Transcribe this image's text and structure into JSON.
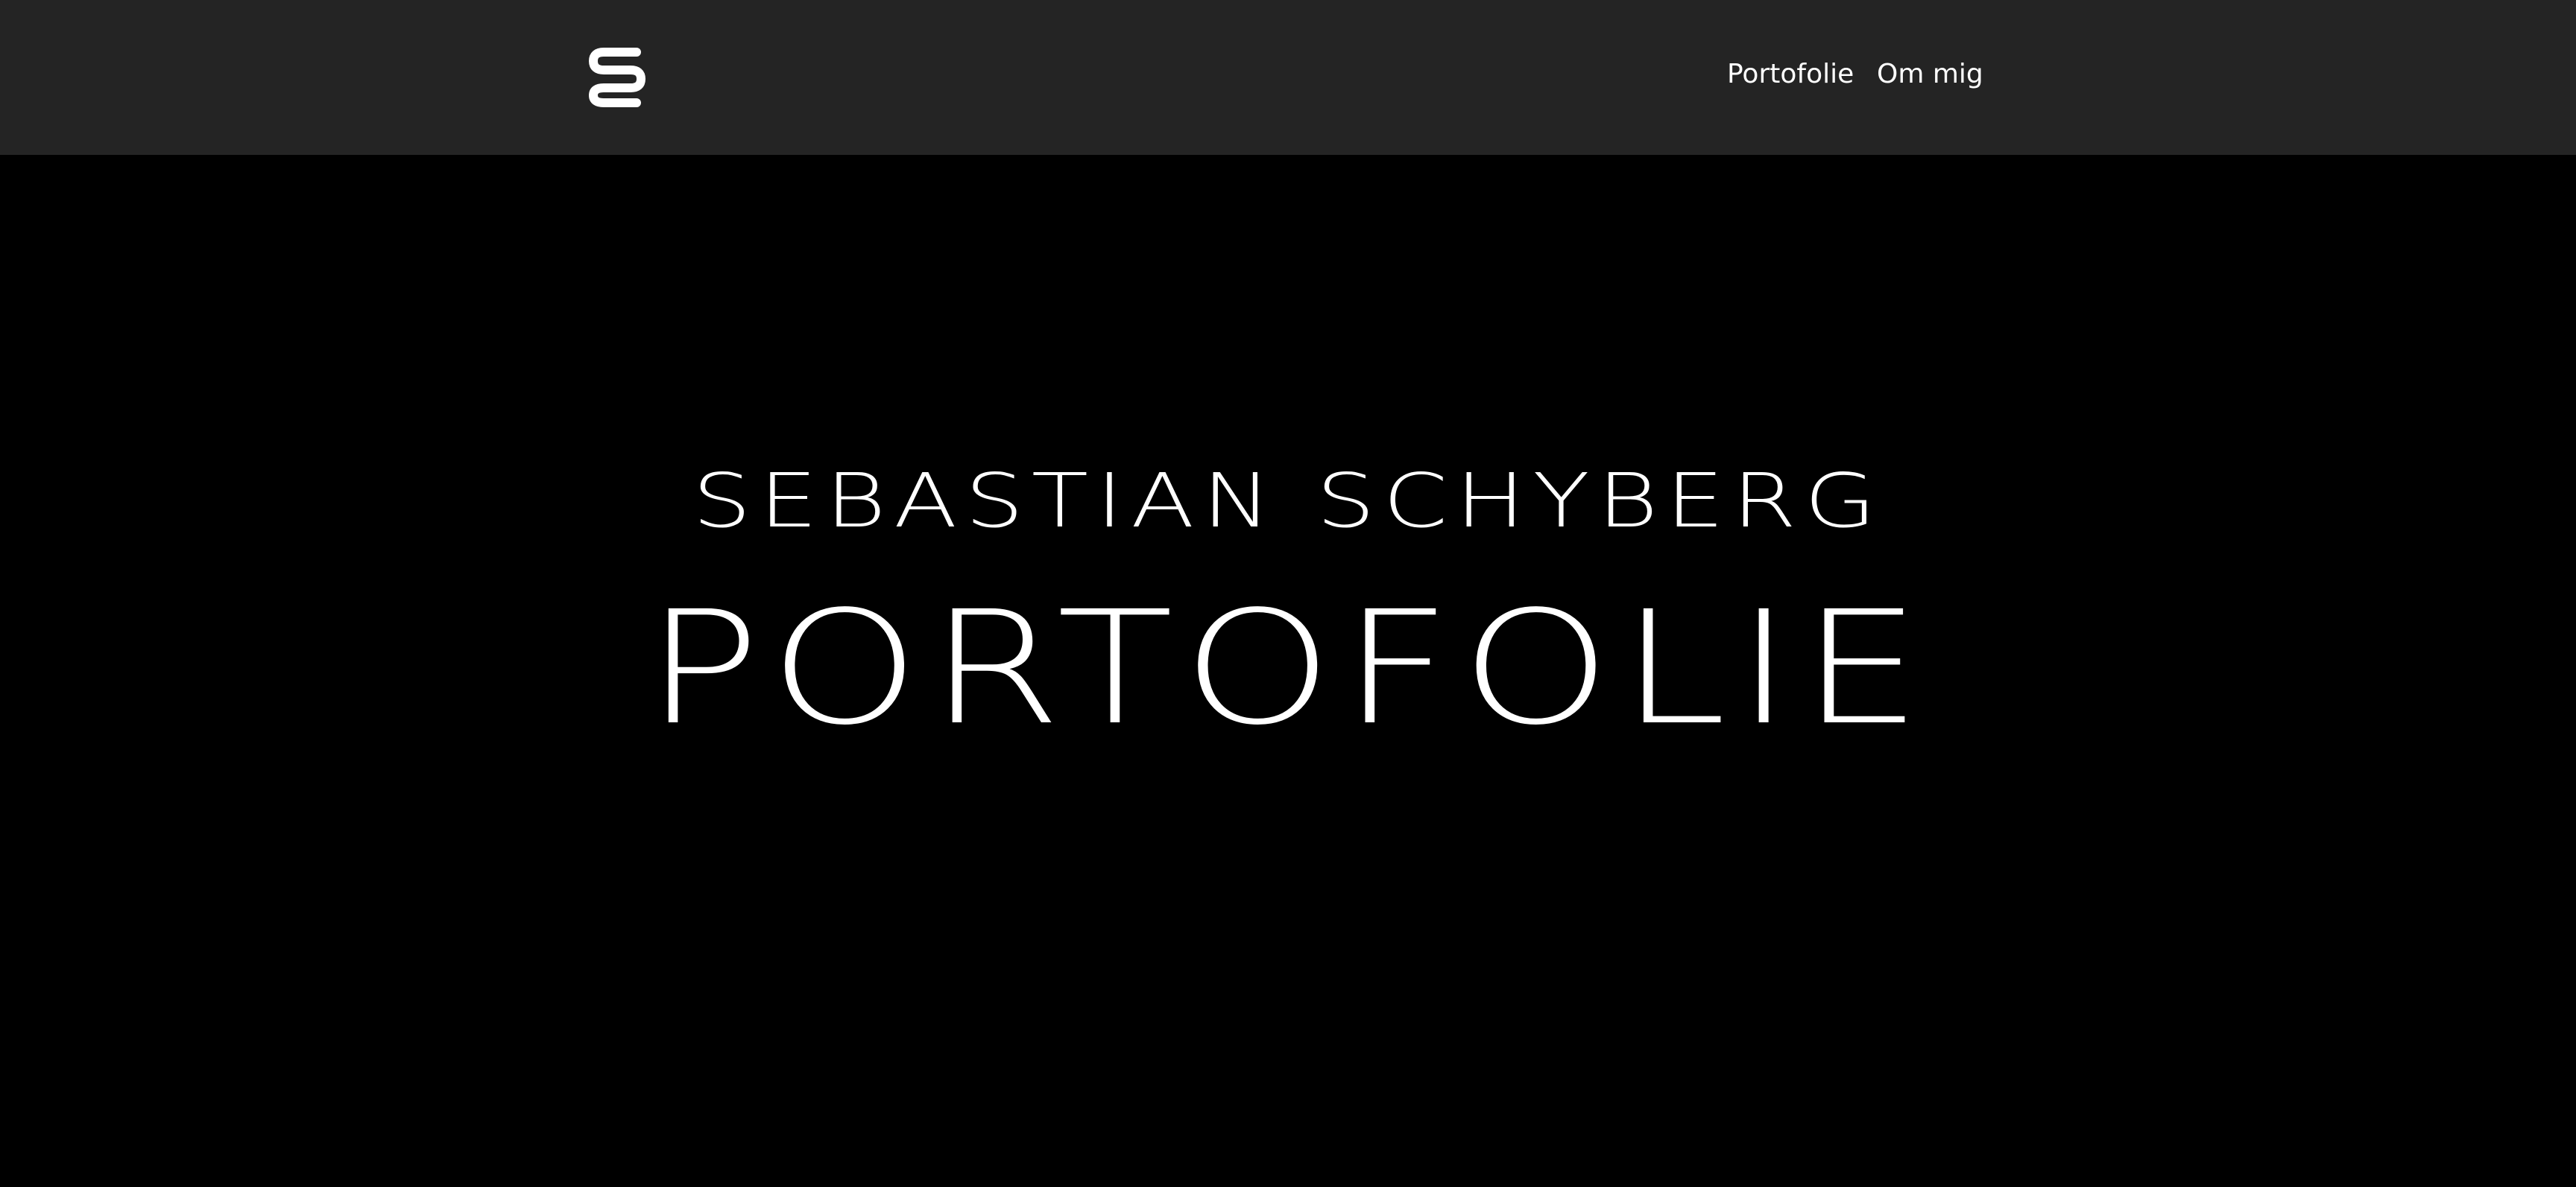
{
  "header": {
    "logo_icon": "stacked-s-logo-icon",
    "nav": [
      {
        "label": "Portofolie"
      },
      {
        "label": "Om mig"
      }
    ]
  },
  "hero": {
    "name": "SEBASTIAN SCHYBERG",
    "title": "PORTOFOLIE"
  },
  "colors": {
    "header_bg": "#242424",
    "page_bg": "#000000",
    "text": "#ffffff"
  }
}
